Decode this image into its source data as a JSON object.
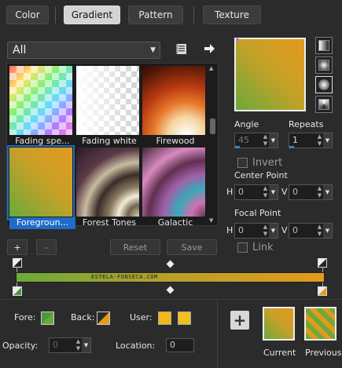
{
  "tabs": [
    {
      "label": "Color",
      "active": false
    },
    {
      "label": "Gradient",
      "active": true
    },
    {
      "label": "Pattern",
      "active": false
    },
    {
      "label": "Texture",
      "active": false
    }
  ],
  "category": {
    "selected": "All"
  },
  "gallery": {
    "items": [
      {
        "label": "Fading spe..."
      },
      {
        "label": "Fading white"
      },
      {
        "label": "Firewood"
      },
      {
        "label": "Foregroun...",
        "selected": true
      },
      {
        "label": "Forest Tones"
      },
      {
        "label": "Galactic"
      }
    ]
  },
  "buttons": {
    "add": "+",
    "remove": "-",
    "reset": "Reset",
    "save": "Save"
  },
  "angle": {
    "label": "Angle",
    "value": "45"
  },
  "repeats": {
    "label": "Repeats",
    "value": "1"
  },
  "invert": {
    "label": "Invert",
    "checked": false
  },
  "center_point": {
    "label": "Center Point",
    "h_label": "H",
    "h": "0",
    "v_label": "V",
    "v": "0"
  },
  "focal_point": {
    "label": "Focal Point",
    "h_label": "H",
    "h": "0",
    "v_label": "V",
    "v": "0"
  },
  "link": {
    "label": "Link",
    "checked": false
  },
  "gradient_bar": {
    "watermark": "ESTELA-FONSECA.COM"
  },
  "colors": {
    "fore": "#6aaa3a",
    "back": "#e39a1c",
    "user1": "#f0b818",
    "user2": "#f0c020"
  },
  "bottom": {
    "fore_label": "Fore:",
    "back_label": "Back:",
    "user_label": "User:",
    "opacity_label": "Opacity:",
    "opacity_value": "0",
    "location_label": "Location:",
    "location_value": "0",
    "current_label": "Current",
    "previous_label": "Previous"
  },
  "icons": {
    "library": "book-icon",
    "next": "arrow-right-icon"
  }
}
